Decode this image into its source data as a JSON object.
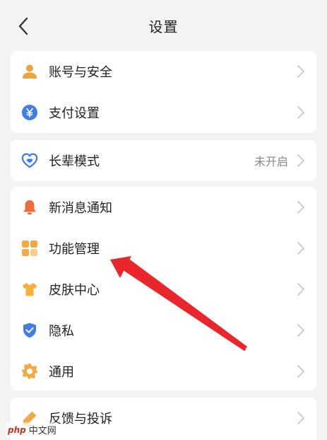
{
  "header": {
    "title": "设置"
  },
  "groups": [
    {
      "items": [
        {
          "label": "账号与安全",
          "icon": "user-icon",
          "color": "#f0a33a"
        },
        {
          "label": "支付设置",
          "icon": "yuan-icon",
          "color": "#3f7ee8"
        }
      ]
    },
    {
      "items": [
        {
          "label": "长辈模式",
          "icon": "heart-mode-icon",
          "color": "#3f7ee8",
          "value": "未开启"
        }
      ]
    },
    {
      "items": [
        {
          "label": "新消息通知",
          "icon": "bell-icon",
          "color": "#f06a3a"
        },
        {
          "label": "功能管理",
          "icon": "grid-icon",
          "color": "#f2a945"
        },
        {
          "label": "皮肤中心",
          "icon": "tshirt-icon",
          "color": "#f4b13a"
        },
        {
          "label": "隐私",
          "icon": "shield-icon",
          "color": "#3f7ee8"
        },
        {
          "label": "通用",
          "icon": "gear-icon",
          "color": "#f2a945"
        }
      ]
    },
    {
      "items": [
        {
          "label": "反馈与投诉",
          "icon": "pen-icon",
          "color": "#f2a945"
        }
      ]
    }
  ],
  "colors": {
    "background": "#f3f3f3",
    "card": "#ffffff",
    "arrow": "#e8262b",
    "chevron": "#c7c7c7"
  },
  "watermark": {
    "logo": "php",
    "text": "中文网"
  }
}
